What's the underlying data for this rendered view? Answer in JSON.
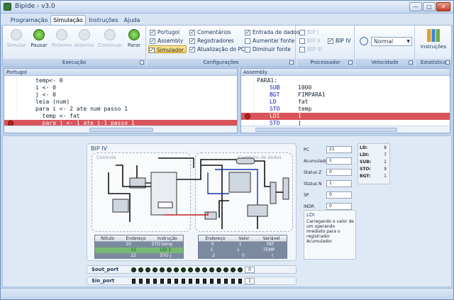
{
  "window": {
    "title": "Bipide - v3.0",
    "minimize": "—",
    "maximize": "□",
    "close": "✕"
  },
  "ribbon_tabs": [
    "Programação",
    "Simulação",
    "Instruções",
    "Ajuda"
  ],
  "execucao": {
    "label": "Execução",
    "buttons": [
      {
        "label": "Simular",
        "enabled": false
      },
      {
        "label": "Pausar",
        "enabled": true
      },
      {
        "label": "Próximo",
        "enabled": false
      },
      {
        "label": "Anterior",
        "enabled": false
      },
      {
        "label": "Continuar",
        "enabled": false
      },
      {
        "label": "Parar",
        "enabled": true
      }
    ]
  },
  "configuracoes": {
    "label": "Configurações",
    "col1": [
      {
        "label": "Portugol",
        "checked": true
      },
      {
        "label": "Assembly",
        "checked": true
      },
      {
        "label": "Simulador",
        "checked": true
      }
    ],
    "col2": [
      {
        "label": "Comentários",
        "checked": true
      },
      {
        "label": "Registradores",
        "checked": true
      },
      {
        "label": "Atualização do PC",
        "checked": true
      }
    ],
    "col3": [
      {
        "label": "Entrada de dados",
        "checked": true
      },
      {
        "label": "Aumentar fonte"
      },
      {
        "label": "Diminuir fonte"
      }
    ]
  },
  "processador": {
    "label": "Processador",
    "options": [
      {
        "label": "BIP I",
        "checked": false
      },
      {
        "label": "BIP II",
        "checked": false
      },
      {
        "label": "BIP III",
        "checked": false
      },
      {
        "label": "BIP IV",
        "checked": true
      }
    ]
  },
  "velocidade": {
    "label": "Velocidade",
    "value": "Normal"
  },
  "estatistica": {
    "label": "Estatística",
    "button": "Instruções"
  },
  "portugol": {
    "title": "Portugol",
    "lines": [
      "temp<- 0",
      "i <- 0",
      "j <- 0",
      "leia (num)",
      "para i <- 2 ate num passo 1",
      "  temp <- fat",
      "  para j <- 1 ate i-1 passo 1"
    ]
  },
  "assembly": {
    "title": "Assembly",
    "lines": [
      {
        "label": "PARA1:",
        "op": "",
        "arg": ""
      },
      {
        "label": "",
        "op": "SUB",
        "arg": "1000"
      },
      {
        "label": "",
        "op": "BGT",
        "arg": "FIMPARA1"
      },
      {
        "label": "",
        "op": "LD",
        "arg": "fat"
      },
      {
        "label": "",
        "op": "STO",
        "arg": "temp"
      },
      {
        "label": "",
        "op": "LDI",
        "arg": "1"
      },
      {
        "label": "",
        "op": "STO",
        "arg": "j"
      }
    ]
  },
  "simulator": {
    "title": "BIP IV",
    "controle_label": "Controle",
    "caminho_label": "Caminho de dados",
    "prog_mem": {
      "headers": [
        "Rótulo",
        "Endereço",
        "Instrução"
      ],
      "rows": [
        {
          "c1": "",
          "c2": "20",
          "c3": "STO temp"
        },
        {
          "c1": "",
          "c2": "21",
          "c3": "LDI 1"
        },
        {
          "c1": "",
          "c2": "22",
          "c3": "STO j"
        }
      ]
    },
    "data_mem": {
      "headers": [
        "Endereço",
        "Valor",
        "Variável"
      ],
      "rows": [
        {
          "c1": "0",
          "c2": "1",
          "c3": "FAT"
        },
        {
          "c1": "1",
          "c2": "1",
          "c3": "TEMP"
        },
        {
          "c1": "2",
          "c2": "0",
          "c3": "I"
        }
      ]
    },
    "registers": [
      {
        "name": "PC",
        "value": "21"
      },
      {
        "name": "Acumulador",
        "value": "1"
      },
      {
        "name": "Status Z",
        "value": "0"
      },
      {
        "name": "Status N",
        "value": "1"
      },
      {
        "name": "SP",
        "value": "0"
      },
      {
        "name": "INDR",
        "value": "0"
      }
    ],
    "instr_count": [
      {
        "name": "LD:",
        "value": "8"
      },
      {
        "name": "LDI:",
        "value": "7"
      },
      {
        "name": "SUB:",
        "value": "1"
      },
      {
        "name": "STO:",
        "value": "9"
      },
      {
        "name": "BGT:",
        "value": "1"
      }
    ],
    "info": {
      "title": "LDI",
      "text": "Carregando o valor de um operando imediato para o registrador Acumulador"
    },
    "out_port": {
      "label": "$out_port",
      "value": "0"
    },
    "in_port": {
      "label": "$in_port",
      "value": "1"
    }
  }
}
